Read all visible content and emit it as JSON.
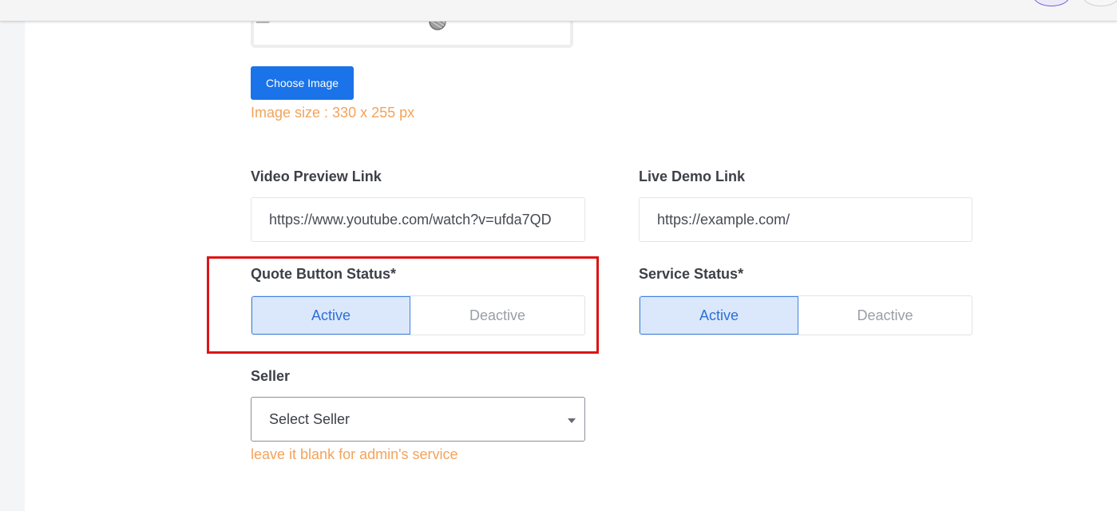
{
  "image_upload": {
    "button_label": "Choose Image",
    "size_hint": "Image size : 330 x 255 px"
  },
  "video_preview": {
    "label": "Video Preview Link",
    "value": "https://www.youtube.com/watch?v=ufda7QD"
  },
  "live_demo": {
    "label": "Live Demo Link",
    "value": "https://example.com/"
  },
  "quote_button_status": {
    "label": "Quote Button Status*",
    "options": [
      "Active",
      "Deactive"
    ],
    "selected": "Active"
  },
  "service_status": {
    "label": "Service Status*",
    "options": [
      "Active",
      "Deactive"
    ],
    "selected": "Active"
  },
  "seller": {
    "label": "Seller",
    "selected_text": "Select Seller",
    "hint": "leave it blank for admin's service"
  },
  "colors": {
    "primary": "#1a73e8",
    "hint": "#f3a35b",
    "active_bg": "#dbe8fb",
    "active_text": "#2c6fd6",
    "highlight": "#dd1515"
  }
}
